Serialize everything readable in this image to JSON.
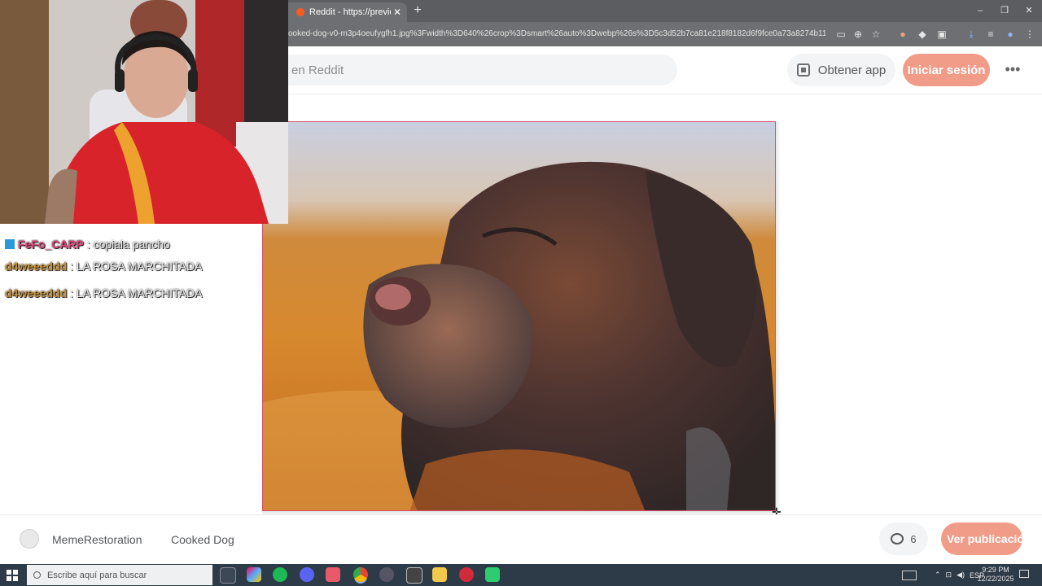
{
  "browser": {
    "tab_title": "Reddit - https://preview.redd.it",
    "tab_close": "✕",
    "new_tab": "+",
    "url": "ooked-dog-v0-m3p4oeufygfh1.jpg%3Fwidth%3D640%26crop%3Dsmart%26auto%3Dwebp%26s%3D5c3d52b7ca81e218f8182d6f9fce0a73a8274b11",
    "window_controls": [
      "–",
      "❐",
      "✕"
    ]
  },
  "reddit_header": {
    "search_placeholder": "en Reddit",
    "get_app_label": "Obtener app",
    "login_label": "Iniciar sesión",
    "more_label": "•••"
  },
  "footer": {
    "subreddit": "MemeRestoration",
    "post_title": "Cooked Dog",
    "comment_count": "6",
    "view_post_label": "Ver publicación"
  },
  "chat": {
    "messages": [
      {
        "user": "FeFo_CARP",
        "text": " : copiala pancho",
        "color": "#e0457a"
      },
      {
        "user": "d4weeeddd",
        "text": " : LA ROSA MARCHITADA",
        "color": "#c8923a"
      },
      {
        "user": "d4weeeddd",
        "text": " : LA ROSA MARCHITADA",
        "color": "#c8923a"
      }
    ]
  },
  "taskbar": {
    "search_placeholder": "Escribe aquí para buscar",
    "language": "ESP",
    "time": "9:29 PM",
    "date": "12/22/2025"
  },
  "colors": {
    "accent": "#f19c88",
    "chrome_dark": "#5c5d60",
    "taskbar": "#2d3a47"
  }
}
